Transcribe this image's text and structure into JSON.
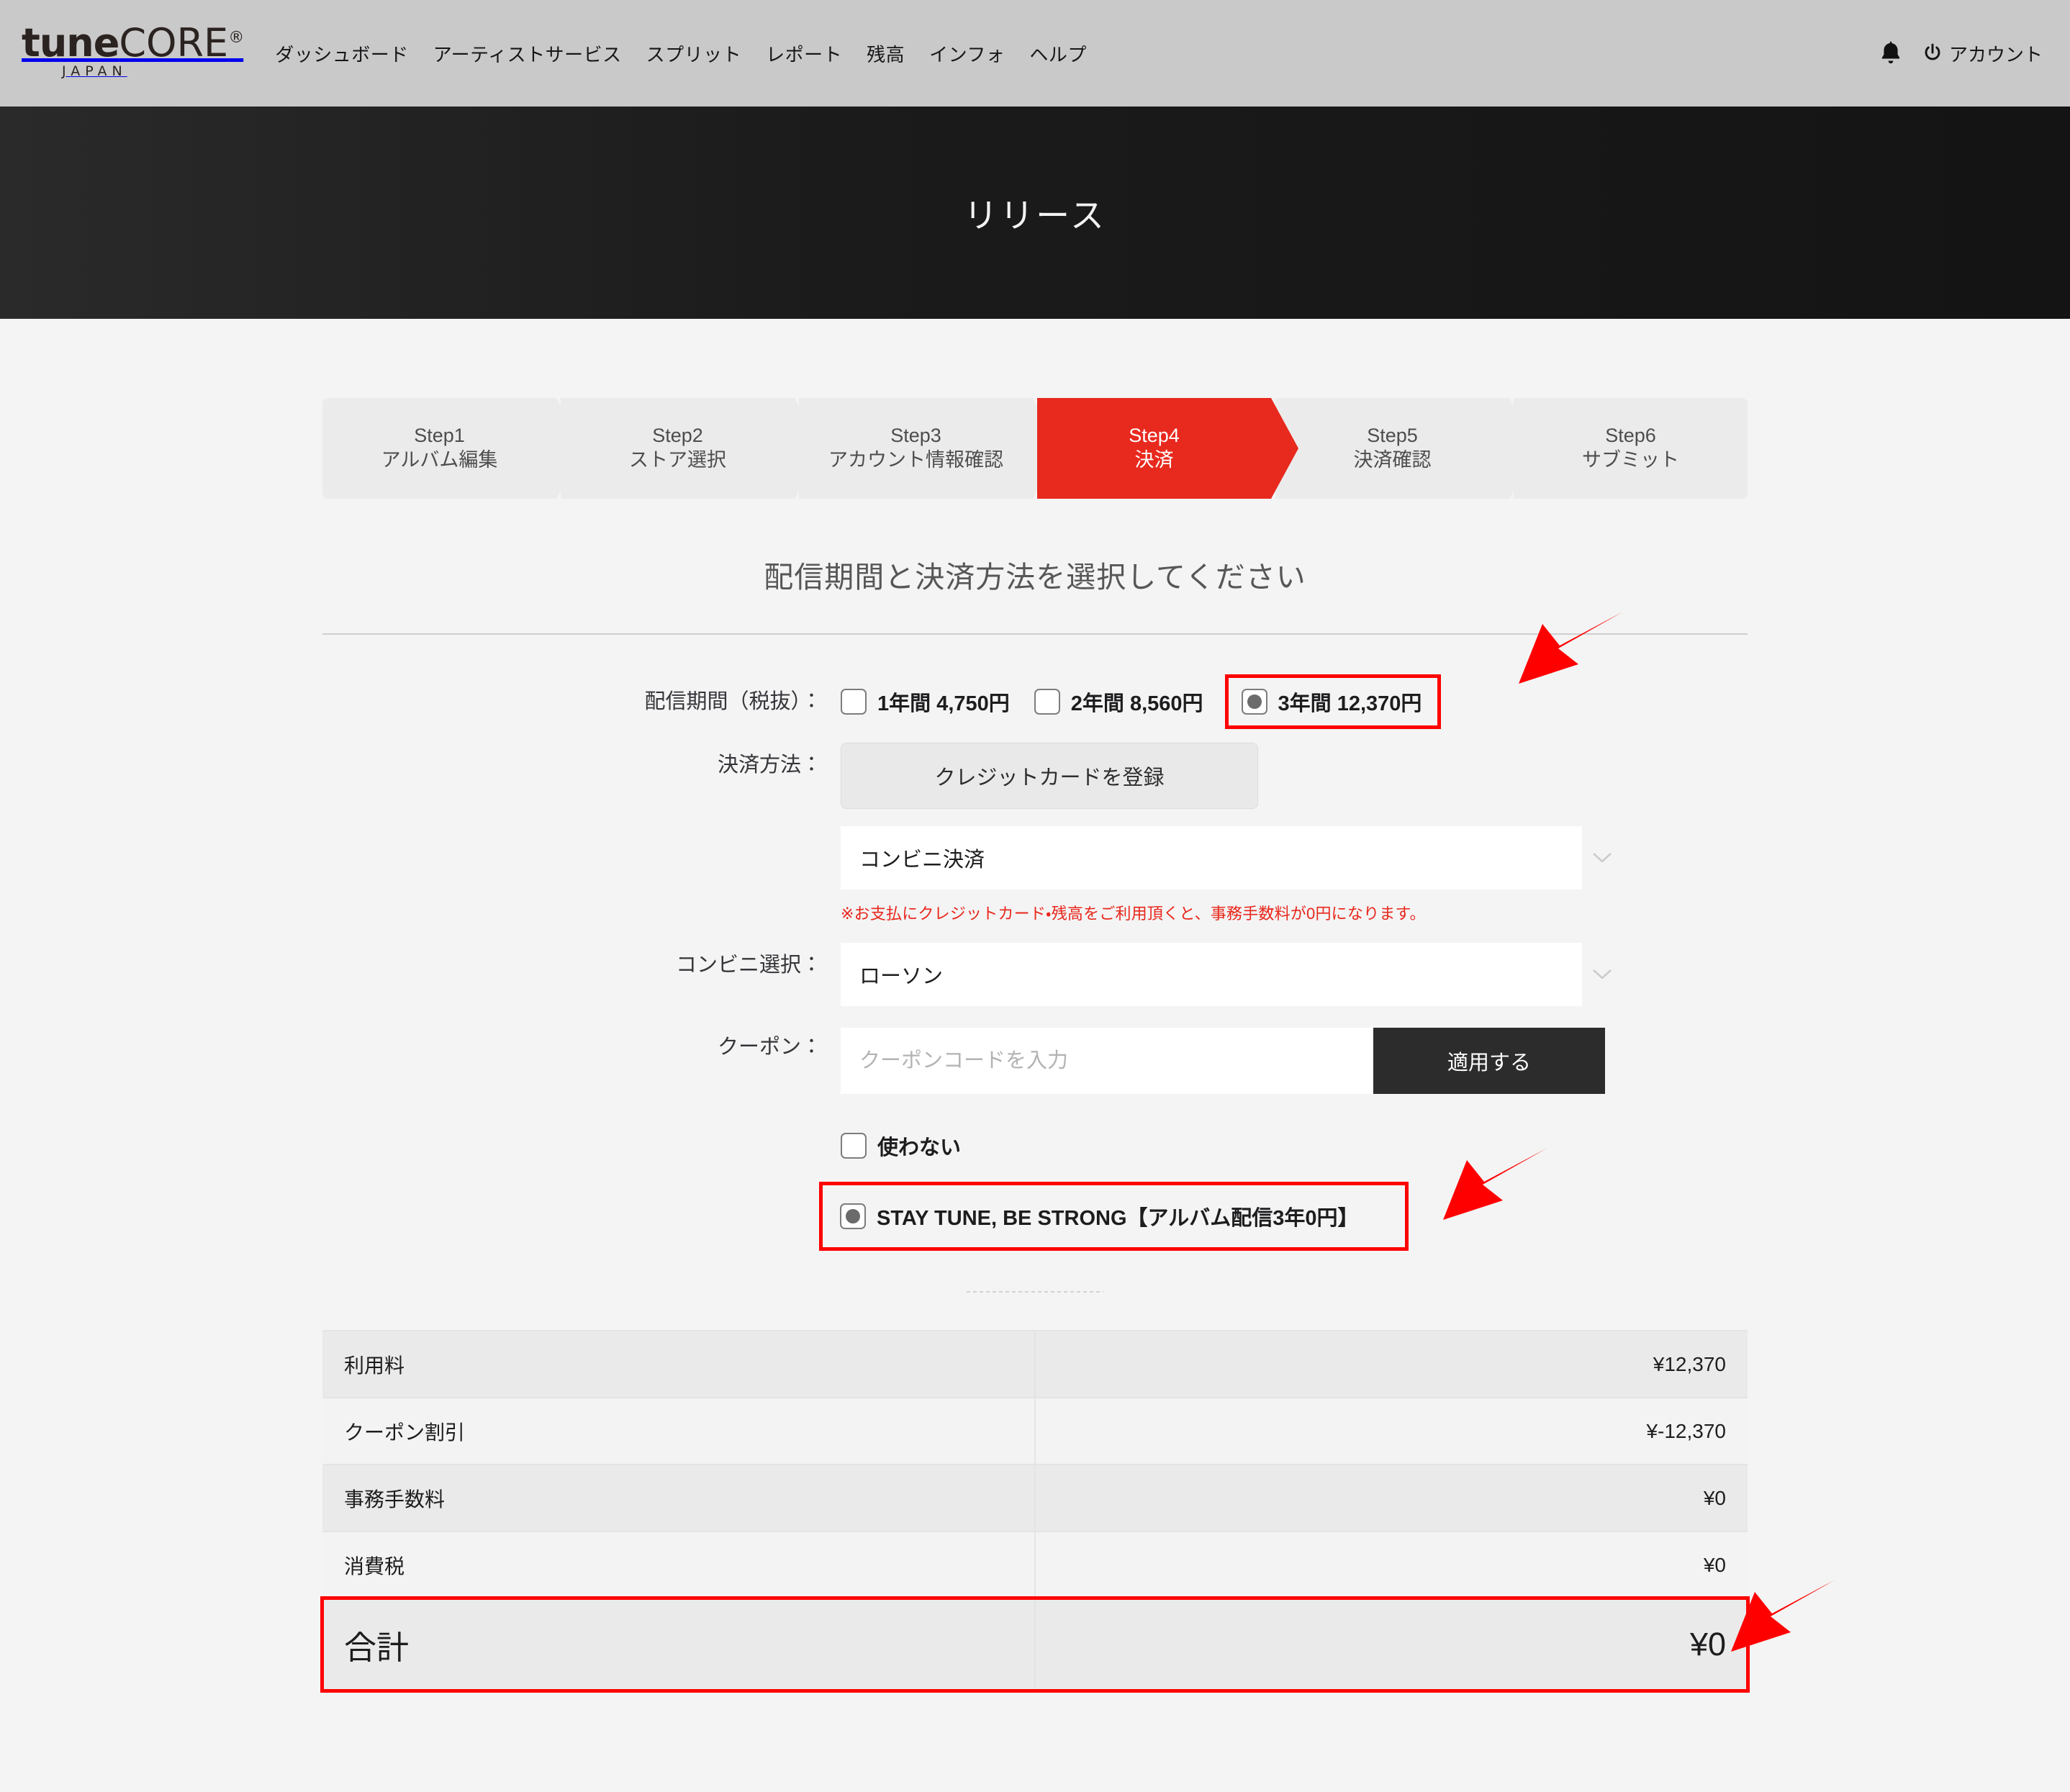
{
  "brand": {
    "logo_bold": "tune",
    "logo_light": "CORE",
    "logo_dot": "®",
    "logo_sub": "JAPAN"
  },
  "topnav": {
    "items": [
      {
        "label": "ダッシュボード"
      },
      {
        "label": "アーティストサービス"
      },
      {
        "label": "スプリット"
      },
      {
        "label": "レポート"
      },
      {
        "label": "残高"
      },
      {
        "label": "インフォ"
      },
      {
        "label": "ヘルプ"
      }
    ],
    "bell_icon": "bell-icon",
    "account_label": "アカウント",
    "power_icon": "power-icon"
  },
  "hero": {
    "title": "リリース"
  },
  "steps": [
    {
      "num": "Step1",
      "label": "アルバム編集",
      "active": false
    },
    {
      "num": "Step2",
      "label": "ストア選択",
      "active": false
    },
    {
      "num": "Step3",
      "label": "アカウント情報確認",
      "active": false
    },
    {
      "num": "Step4",
      "label": "決済",
      "active": true
    },
    {
      "num": "Step5",
      "label": "決済確認",
      "active": false
    },
    {
      "num": "Step6",
      "label": "サブミット",
      "active": false
    }
  ],
  "form": {
    "title": "配信期間と決済方法を選択してください",
    "period": {
      "label": "配信期間（税抜）：",
      "options": [
        {
          "label": "1年間 4,750円",
          "selected": false
        },
        {
          "label": "2年間 8,560円",
          "selected": false
        },
        {
          "label": "3年間 12,370円",
          "selected": true
        }
      ]
    },
    "payment": {
      "label": "決済方法：",
      "register_card_button": "クレジットカードを登録",
      "method_selected": "コンビニ決済",
      "chevron_icon": "chevron-down-icon",
      "note": "※お支払にクレジットカード・残高をご利用頂くと、事務手数料が0円になります。"
    },
    "conbini": {
      "label": "コンビニ選択：",
      "selected": "ローソン",
      "chevron_icon": "chevron-down-icon"
    },
    "coupon": {
      "label": "クーポン：",
      "placeholder": "クーポンコードを入力",
      "value": "",
      "apply_button": "適用する",
      "options": [
        {
          "label": "使わない",
          "selected": false
        },
        {
          "label": "STAY TUNE, BE STRONG【アルバム配信3年0円】",
          "selected": true
        }
      ]
    }
  },
  "price_table": {
    "rows": [
      {
        "key": "利用料",
        "value": "¥12,370"
      },
      {
        "key": "クーポン割引",
        "value": "¥-12,370"
      },
      {
        "key": "事務手数料",
        "value": "¥0"
      },
      {
        "key": "消費税",
        "value": "¥0"
      }
    ],
    "total": {
      "key": "合計",
      "value": "¥0"
    }
  },
  "annotations": {
    "arrow_color": "#ff0000",
    "highlight_color": "#ff0000",
    "arrows": [
      {
        "name": "arrow-to-period-option"
      },
      {
        "name": "arrow-to-coupon-option"
      },
      {
        "name": "arrow-to-total"
      }
    ]
  },
  "colors": {
    "accent_red": "#e8291e",
    "header_bg": "#c9c9c9",
    "hero_bg": "#1b1b1b",
    "page_bg": "#f4f4f4"
  }
}
